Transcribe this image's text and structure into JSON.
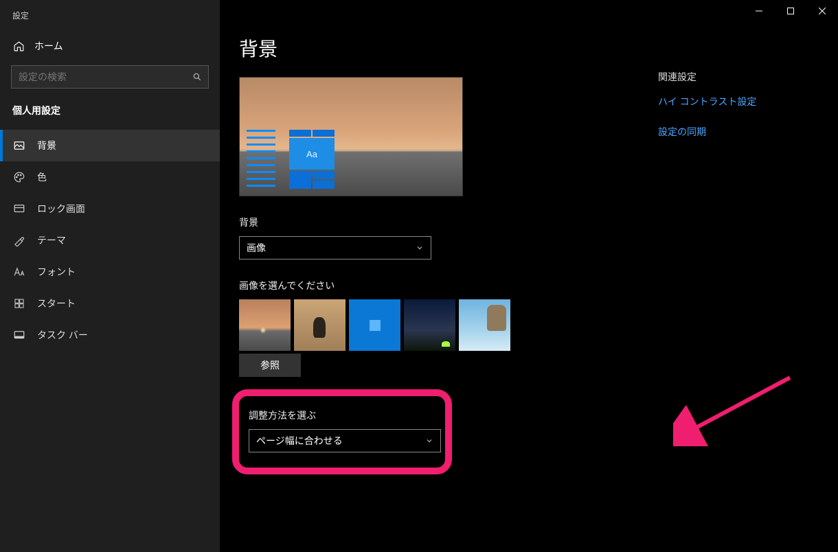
{
  "window": {
    "title": "設定"
  },
  "sidebar": {
    "home": "ホーム",
    "search_placeholder": "設定の検索",
    "section_label": "個人用設定",
    "items": [
      {
        "label": "背景",
        "icon": "background-icon"
      },
      {
        "label": "色",
        "icon": "color-icon"
      },
      {
        "label": "ロック画面",
        "icon": "lockscreen-icon"
      },
      {
        "label": "テーマ",
        "icon": "theme-icon"
      },
      {
        "label": "フォント",
        "icon": "font-icon"
      },
      {
        "label": "スタート",
        "icon": "start-icon"
      },
      {
        "label": "タスク バー",
        "icon": "taskbar-icon"
      }
    ]
  },
  "main": {
    "heading": "背景",
    "preview_aa": "Aa",
    "bg_label": "背景",
    "bg_value": "画像",
    "choose_label": "画像を選んでください",
    "browse": "参照",
    "fit_label": "調整方法を選ぶ",
    "fit_value": "ページ幅に合わせる"
  },
  "right": {
    "heading": "関連設定",
    "links": [
      "ハイ コントラスト設定",
      "設定の同期"
    ]
  }
}
